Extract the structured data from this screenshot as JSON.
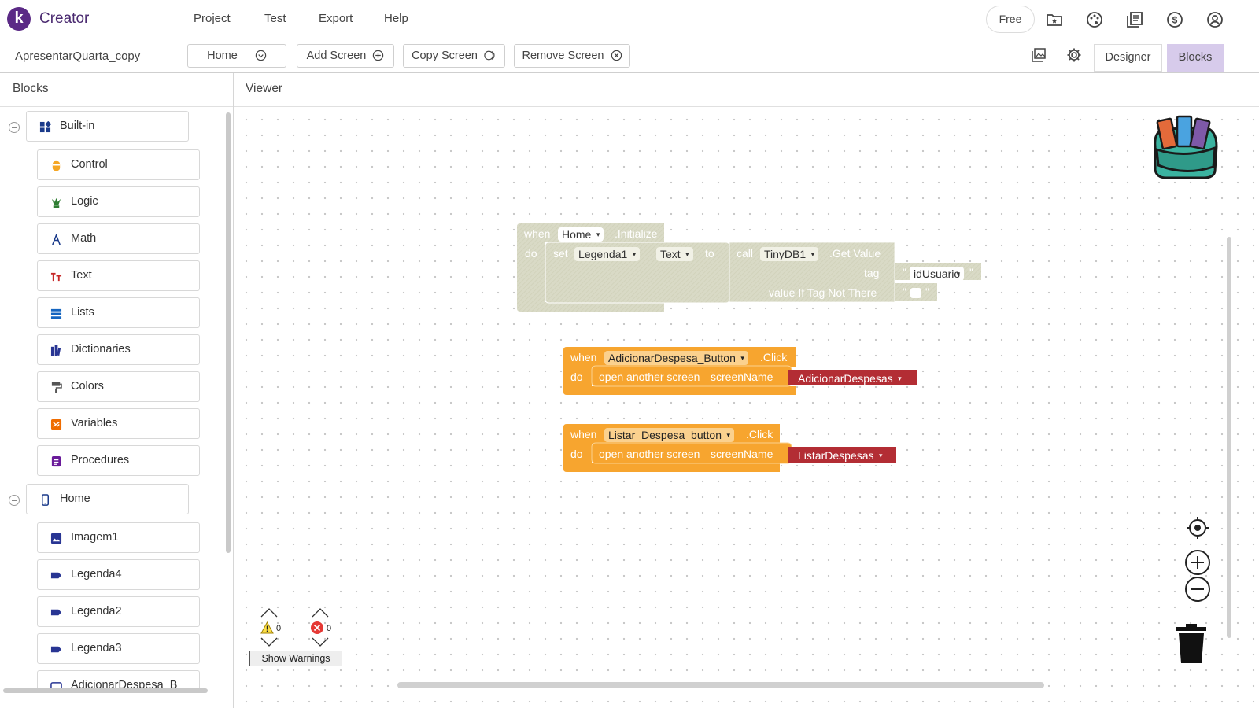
{
  "app": {
    "logo_letter": "k",
    "name": "Creator"
  },
  "menu": [
    "Project",
    "Test",
    "Export",
    "Help"
  ],
  "topbar": {
    "free_label": "Free",
    "icons": [
      "folder-star-icon",
      "palette-icon",
      "library-icon",
      "dollar-icon",
      "account-icon"
    ]
  },
  "toolbar": {
    "project_name": "ApresentarQuarta_copy",
    "screen_select": "Home",
    "add_screen": "Add Screen",
    "copy_screen": "Copy Screen",
    "remove_screen": "Remove Screen",
    "designer": "Designer",
    "blocks": "Blocks"
  },
  "blocks_panel": {
    "title": "Blocks",
    "builtin_label": "Built-in",
    "builtin_items": [
      {
        "label": "Control",
        "icon": "control-icon",
        "color": "#f5a623"
      },
      {
        "label": "Logic",
        "icon": "logic-icon",
        "color": "#2e7d32"
      },
      {
        "label": "Math",
        "icon": "math-icon",
        "color": "#1a3a8a"
      },
      {
        "label": "Text",
        "icon": "text-icon",
        "color": "#c62828"
      },
      {
        "label": "Lists",
        "icon": "lists-icon",
        "color": "#1565c0"
      },
      {
        "label": "Dictionaries",
        "icon": "dictionaries-icon",
        "color": "#283593"
      },
      {
        "label": "Colors",
        "icon": "colors-icon",
        "color": "#555555"
      },
      {
        "label": "Variables",
        "icon": "variables-icon",
        "color": "#ef6c00"
      },
      {
        "label": "Procedures",
        "icon": "procedures-icon",
        "color": "#6a1b9a"
      }
    ],
    "screen_label": "Home",
    "component_items": [
      {
        "label": "Imagem1",
        "icon": "image-icon"
      },
      {
        "label": "Legenda4",
        "icon": "label-icon"
      },
      {
        "label": "Legenda2",
        "icon": "label-icon"
      },
      {
        "label": "Legenda3",
        "icon": "label-icon"
      },
      {
        "label": "AdicionarDespesa_B",
        "icon": "button-icon"
      }
    ]
  },
  "viewer": {
    "title": "Viewer",
    "block_init": {
      "when": "when",
      "component": "Home",
      "event": ".Initialize",
      "do": "do",
      "set": "set",
      "target": "Legenda1",
      "property": "Text",
      "to": "to",
      "call": "call",
      "db": "TinyDB1",
      "method": ".Get Value",
      "tag_label": "tag",
      "tag_value": "idUsuario",
      "notthere_label": "value If Tag Not There",
      "quote": "\""
    },
    "block_add": {
      "when": "when",
      "component": "AdicionarDespesa_Button",
      "event": ".Click",
      "do": "do",
      "action": "open another screen",
      "param": "screenName",
      "value": "AdicionarDespesas"
    },
    "block_list": {
      "when": "when",
      "component": "Listar_Despesa_button",
      "event": ".Click",
      "do": "do",
      "action": "open another screen",
      "param": "screenName",
      "value": "ListarDespesas"
    },
    "warnings": {
      "warning_count": "0",
      "error_count": "0",
      "button": "Show Warnings"
    }
  },
  "colors": {
    "event_orange": "#f7a52f",
    "event_orange_dark": "#e08e1a",
    "disabled_block": "#d8d9c4",
    "screen_value_red": "#b32d34",
    "brand_purple": "#5b2a86",
    "active_tab": "#d7cbeb"
  }
}
